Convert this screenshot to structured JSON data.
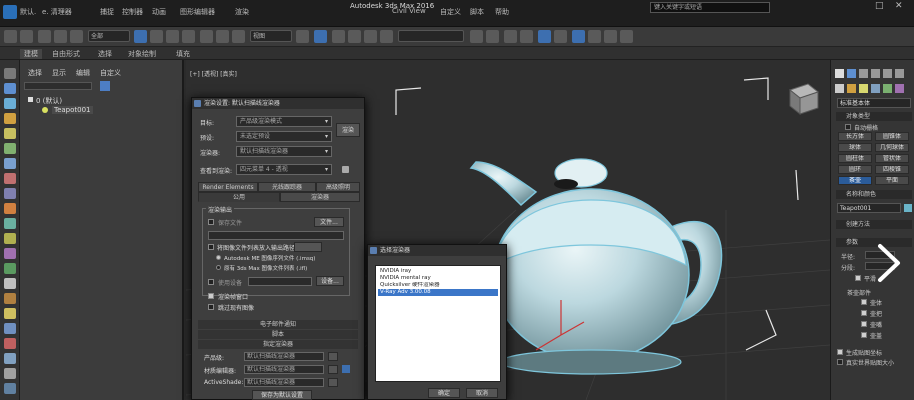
{
  "titlebar": {
    "window_title": "Autodesk 3ds Max 2016",
    "search_placeholder": "键入关键字或短语",
    "items": [
      "默认.",
      "e. 清理器",
      "捕捉",
      "控制器",
      "动画",
      "图形编辑器",
      "渲染",
      "Civil View",
      "自定义",
      "脚本",
      "帮助"
    ]
  },
  "main_toolbar": {
    "selection_filter": "全部",
    "view_dropdown": "视图"
  },
  "ribbon": {
    "tabs": [
      "建模",
      "自由形式",
      "选择",
      "对象绘制",
      "填充"
    ]
  },
  "scene_explorer": {
    "tabs": [
      "选择",
      "显示",
      "编辑",
      "自定义"
    ],
    "tree": [
      {
        "label": "0 (默认)",
        "level": 0
      },
      {
        "label": "Teapot001",
        "level": 1
      }
    ]
  },
  "viewport": {
    "label": "[+] [透视] [真实]"
  },
  "render_dialog": {
    "title": "渲染设置: 默认扫描线渲染器",
    "fields": [
      {
        "label": "目标:",
        "value": "产品级渲染模式"
      },
      {
        "label": "预设:",
        "value": "未选定预设"
      },
      {
        "label": "渲染器:",
        "value": "默认扫描线渲染器"
      },
      {
        "label": "查看到渲染:",
        "value": "四元菜单 4 - 透视"
      }
    ],
    "render_button": "渲染",
    "tabs_row1": [
      "Render Elements",
      "光线跟踪器",
      "高级照明"
    ],
    "tabs_row2": [
      "公用",
      "渲染器"
    ],
    "group_title": "渲染输出",
    "save_file_label": "保存文件",
    "files_button": "文件...",
    "radio_device": "将图像文件列表放入输出路径",
    "radio_autodesk": "Autodesk ME 图像序列文件 (.imsq)",
    "radio_legacy": "原有 3ds Max 图像文件列表 (.ifl)",
    "use_device_label": "使用设备",
    "device_button": "设备...",
    "rendered_frame_window": "渲染帧窗口",
    "skip_existing": "跳过现有图像",
    "rollouts": [
      "电子邮件通知",
      "脚本",
      "指定渲染器"
    ],
    "assign_rows": [
      {
        "label": "产品级:",
        "value": "默认扫描线渲染器"
      },
      {
        "label": "材质编辑器:",
        "value": "默认扫描线渲染器"
      },
      {
        "label": "ActiveShade:",
        "value": "默认扫描线渲染器"
      }
    ],
    "save_default": "保存为默认设置"
  },
  "choose_dialog": {
    "title": "选择渲染器",
    "items": [
      {
        "label": "NVIDIA iray",
        "selected": false
      },
      {
        "label": "NVIDIA mental ray",
        "selected": false
      },
      {
        "label": "Quicksilver 硬件渲染器",
        "selected": false
      },
      {
        "label": "V-Ray Adv 3.00.08",
        "selected": true
      }
    ],
    "ok_button": "确定",
    "cancel_button": "取消"
  },
  "right_panel": {
    "category": "标准基本体",
    "rollout_object_type": "对象类型",
    "auto_grid": "自动栅格",
    "buttons": [
      "长方体",
      "圆锥体",
      "球体",
      "几何球体",
      "圆柱体",
      "管状体",
      "圆环",
      "四棱锥",
      "茶壶",
      "平面"
    ],
    "selected_button": "茶壶",
    "rollout_name_color": "名称和颜色",
    "object_name": "Teapot001",
    "rollout_creation": "创建方法",
    "rollout_params": "参数",
    "radius_label": "半径:",
    "segments_label": "分段:",
    "smooth_label": "平滑",
    "teapot_parts_label": "茶壶部件",
    "parts": [
      "壶体",
      "壶把",
      "壶嘴",
      "壶盖"
    ],
    "gen_mapping": "生成贴图坐标",
    "real_world": "真实世界贴图大小"
  },
  "colors": {
    "accent": "#3d6fb0",
    "teapot": "#bcd8df",
    "dialog_bg": "#3e3e3e"
  }
}
